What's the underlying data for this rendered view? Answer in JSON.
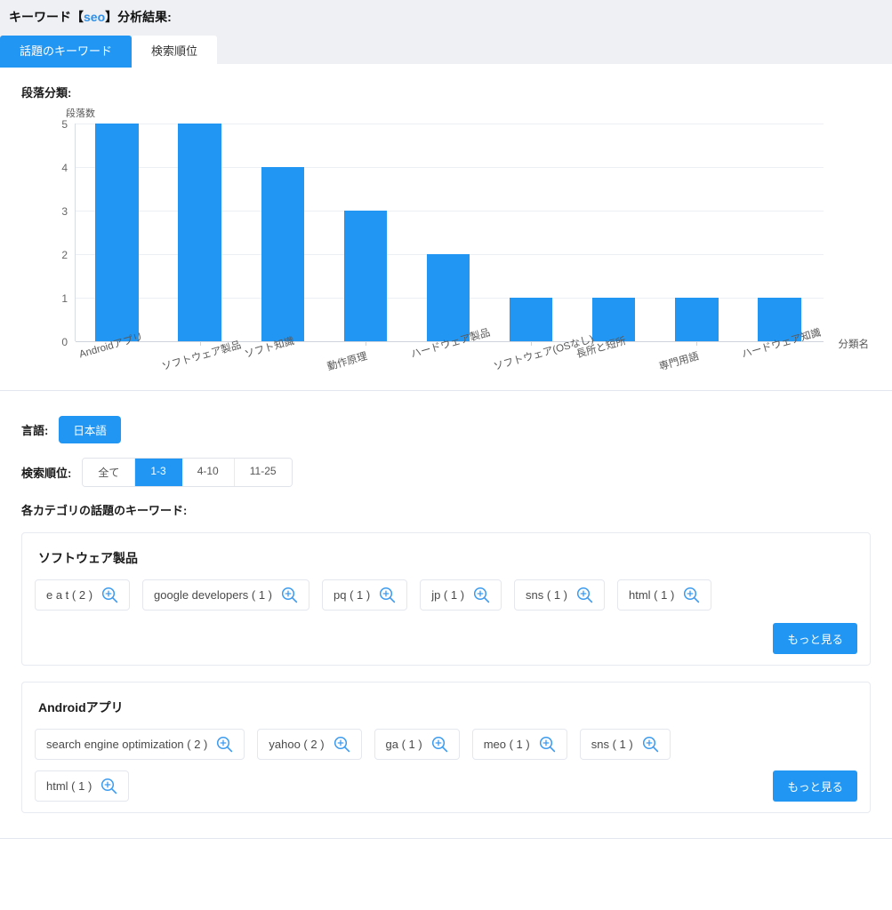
{
  "header": {
    "title_prefix": "キーワード【",
    "keyword": "seo",
    "title_suffix": "】分析結果:",
    "tabs": [
      {
        "label": "話題のキーワード",
        "active": true
      },
      {
        "label": "検索順位",
        "active": false
      }
    ]
  },
  "chart_section": {
    "label": "段落分類:"
  },
  "chart_data": {
    "type": "bar",
    "title": "段落分類:",
    "ylabel": "段落数",
    "xlabel": "分類名",
    "categories": [
      "Androidアプリ",
      "ソフトウェア製品",
      "ソフト知識",
      "動作原理",
      "ハードウェア製品",
      "ソフトウェア(OSなし)",
      "長所と短所",
      "専門用語",
      "ハードウェア知識"
    ],
    "values": [
      5,
      5,
      4,
      3,
      2,
      1,
      1,
      1,
      1
    ],
    "yticks": [
      0,
      1,
      2,
      3,
      4,
      5
    ],
    "ylim": [
      0,
      5
    ],
    "grid": true,
    "legend": "none",
    "bar_color": "#2196f3"
  },
  "filters": {
    "language": {
      "label": "言語:",
      "options": [
        {
          "label": "日本語",
          "active": true
        }
      ]
    },
    "rank": {
      "label": "検索順位:",
      "options": [
        {
          "label": "全て",
          "active": false
        },
        {
          "label": "1-3",
          "active": true
        },
        {
          "label": "4-10",
          "active": false
        },
        {
          "label": "11-25",
          "active": false
        }
      ]
    }
  },
  "keywords_section": {
    "heading": "各カテゴリの話題のキーワード:",
    "more_label": "もっと見る",
    "cards": [
      {
        "title": "ソフトウェア製品",
        "chips": [
          "e a t ( 2 )",
          "google developers ( 1 )",
          "pq ( 1 )",
          "jp ( 1 )",
          "sns ( 1 )",
          "html ( 1 )"
        ]
      },
      {
        "title": "Androidアプリ",
        "chips": [
          "search engine optimization ( 2 )",
          "yahoo ( 2 )",
          "ga ( 1 )",
          "meo ( 1 )",
          "sns ( 1 )",
          "html ( 1 )"
        ]
      }
    ]
  },
  "colors": {
    "accent": "#2196f3",
    "header_band": "#eef0f4",
    "border": "#e7eaf0"
  }
}
